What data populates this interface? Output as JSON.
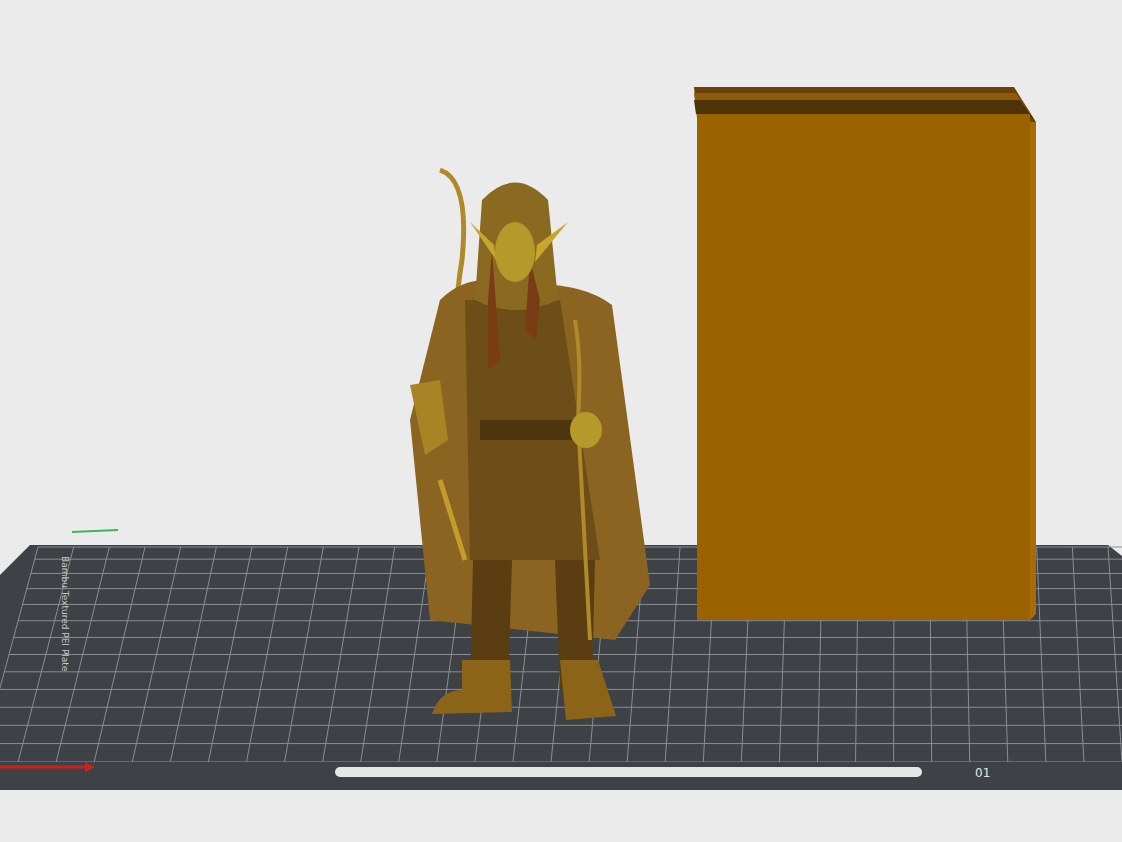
{
  "viewport": {
    "plate_label": "Bambu Textured PEI Plate",
    "plate_number": "01"
  },
  "objects": [
    {
      "name": "elf-ranger-figurine",
      "selected": false,
      "color": "#8a6420"
    },
    {
      "name": "box",
      "selected": false,
      "color": "#9b6200"
    }
  ]
}
